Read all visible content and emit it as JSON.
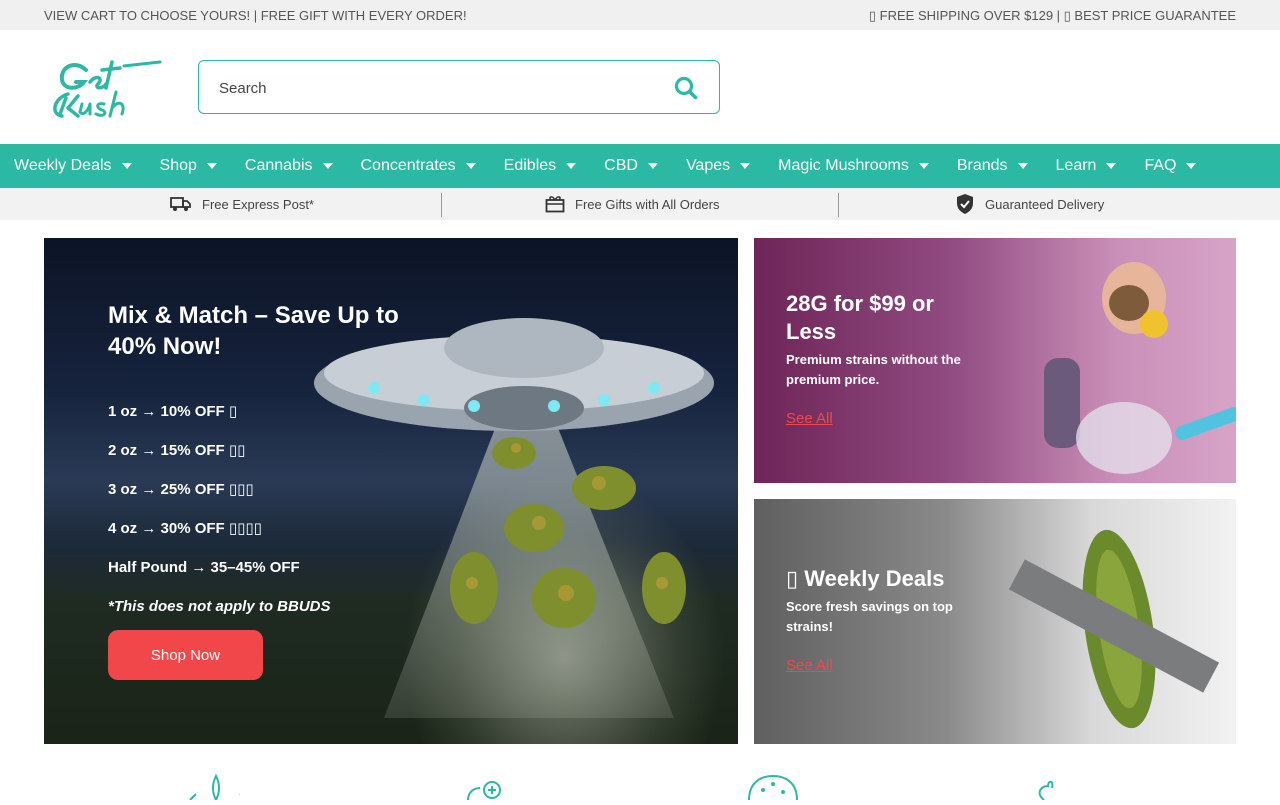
{
  "announcement": {
    "left": "VIEW CART TO CHOOSE YOURS! | FREE GIFT WITH EVERY ORDER!",
    "right": "▯ FREE SHIPPING OVER $129  | ▯ BEST PRICE GUARANTEE"
  },
  "header": {
    "logo_text": "Get Kush",
    "search_placeholder": "Search"
  },
  "nav": {
    "items": [
      {
        "label": "Weekly Deals"
      },
      {
        "label": "Shop"
      },
      {
        "label": "Cannabis"
      },
      {
        "label": "Concentrates"
      },
      {
        "label": "Edibles"
      },
      {
        "label": "CBD"
      },
      {
        "label": "Vapes"
      },
      {
        "label": "Magic Mushrooms"
      },
      {
        "label": "Brands"
      },
      {
        "label": "Learn"
      },
      {
        "label": "FAQ"
      }
    ]
  },
  "perks": {
    "shipping": "Free Express Post*",
    "gifts": "Free Gifts with All Orders",
    "delivery": "Guaranteed Delivery"
  },
  "hero": {
    "title": "Mix & Match – Save Up to 40% Now!",
    "tiers": [
      "1 oz → 10% OFF ▯",
      "2 oz → 15% OFF ▯▯",
      "3 oz → 25% OFF ▯▯▯",
      "4 oz → 30% OFF ▯▯▯▯",
      "Half Pound → 35–45% OFF"
    ],
    "note": "*This does not apply to BBUDS",
    "cta": "Shop Now"
  },
  "promos": [
    {
      "title": "28G for $99 or Less",
      "subtitle": "Premium strains without the premium price.",
      "link": "See All"
    },
    {
      "title": "▯ Weekly Deals",
      "subtitle": "Score fresh savings on top strains!",
      "link": "See All"
    }
  ],
  "colors": {
    "brand": "#2bb9a4",
    "cta": "#f2474a"
  }
}
